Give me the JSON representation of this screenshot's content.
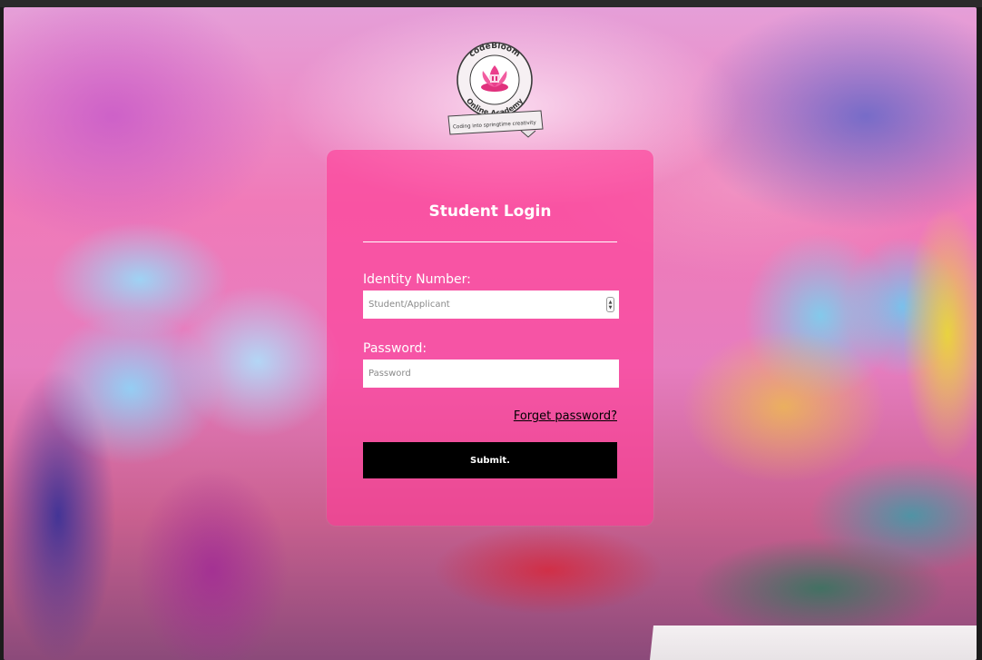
{
  "brand": {
    "name": "codeBloom",
    "subtitle": "Online Academy",
    "tagline": "Coding into springtime creativity"
  },
  "login": {
    "title": "Student Login",
    "identity_label": "Identity Number:",
    "identity_placeholder": "Student/Applicant",
    "password_label": "Password:",
    "password_placeholder": "Password",
    "forgot_link": "Forget password?",
    "submit_label": "Submit."
  },
  "colors": {
    "card": "#ff3c96",
    "button": "#000000",
    "text_light": "#ffffff"
  },
  "icons": {
    "logo": "lotus-logo-icon",
    "spinner": "number-spinner-icon"
  }
}
